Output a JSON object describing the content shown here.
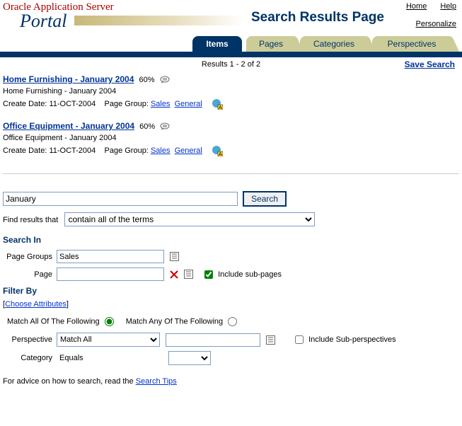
{
  "header": {
    "app_server": "Oracle Application Server",
    "portal": "Portal",
    "page_title": "Search Results Page",
    "links": {
      "home": "Home",
      "help": "Help",
      "personalize": "Personalize"
    }
  },
  "tabs": {
    "items_label": "Items",
    "pages_label": "Pages",
    "categories_label": "Categories",
    "perspectives_label": "Perspectives"
  },
  "results_header": {
    "text": "Results 1 - 2 of 2",
    "save": "Save Search"
  },
  "results": [
    {
      "title": "Home Furnishing - January 2004",
      "pct": "60%",
      "desc": "Home Furnishing - January 2004",
      "create_label": "Create Date:",
      "create_date": "11-OCT-2004",
      "pg_label": "Page Group:",
      "pg_link1": "Sales",
      "pg_link2": "General"
    },
    {
      "title": "Office Equipment - January 2004",
      "pct": "60%",
      "desc": "Office Equipment - January 2004",
      "create_label": "Create Date:",
      "create_date": "11-OCT-2004",
      "pg_label": "Page Group:",
      "pg_link1": "Sales",
      "pg_link2": "General"
    }
  ],
  "search": {
    "value": "January",
    "button": "Search",
    "find_label": "Find results that",
    "find_option": "contain all of the terms"
  },
  "search_in": {
    "title": "Search In",
    "page_groups_label": "Page Groups",
    "page_groups_value": "Sales",
    "page_label": "Page",
    "include_sub": "Include sub-pages"
  },
  "filter_by": {
    "title": "Filter By",
    "choose_attr": "Choose Attributes",
    "match_all": "Match All Of The Following",
    "match_any": "Match Any Of The Following",
    "perspective_label": "Perspective",
    "perspective_match": "Match All",
    "include_sub_persp": "Include Sub-perspectives",
    "category_label": "Category",
    "category_op": "Equals"
  },
  "advice": {
    "prefix": "For advice on how to search, read the ",
    "link": "Search Tips"
  }
}
